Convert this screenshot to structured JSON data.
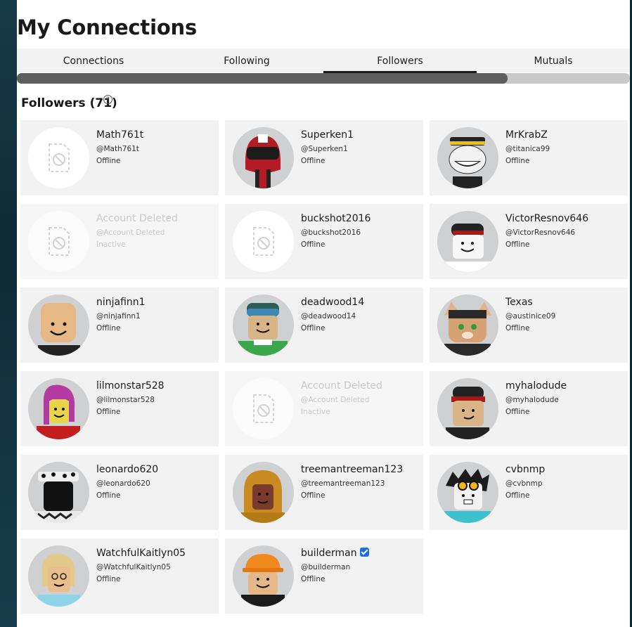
{
  "page_title": "My Connections",
  "tabs": [
    {
      "label": "Connections",
      "active": false
    },
    {
      "label": "Following",
      "active": false
    },
    {
      "label": "Followers",
      "active": true
    },
    {
      "label": "Mutuals",
      "active": false
    }
  ],
  "section": {
    "title": "Followers (71)",
    "help_icon": "question-circle-icon"
  },
  "horizontal_scroll_fraction": 0.8,
  "followers": [
    {
      "name": "Math761t",
      "handle": "@Math761t",
      "status": "Offline",
      "avatar": "blank"
    },
    {
      "name": "Superken1",
      "handle": "@Superken1",
      "status": "Offline",
      "avatar": "helmet"
    },
    {
      "name": "MrKrabZ",
      "handle": "@titanica99",
      "status": "Offline",
      "avatar": "trollface"
    },
    {
      "name": "Account Deleted",
      "handle": "@Account Deleted",
      "status": "Inactive",
      "avatar": "blank",
      "deleted": true
    },
    {
      "name": "buckshot2016",
      "handle": "@buckshot2016",
      "status": "Offline",
      "avatar": "blank"
    },
    {
      "name": "VictorResnov646",
      "handle": "@VictorResnov646",
      "status": "Offline",
      "avatar": "white-cap"
    },
    {
      "name": "ninjafinn1",
      "handle": "@ninjafinn1",
      "status": "Offline",
      "avatar": "bald"
    },
    {
      "name": "deadwood14",
      "handle": "@deadwood14",
      "status": "Offline",
      "avatar": "goggles"
    },
    {
      "name": "Texas",
      "handle": "@austinice09",
      "status": "Offline",
      "avatar": "cat"
    },
    {
      "name": "lilmonstar528",
      "handle": "@lilmonstar528",
      "status": "Offline",
      "avatar": "pink-hair"
    },
    {
      "name": "Account Deleted",
      "handle": "@Account Deleted",
      "status": "Inactive",
      "avatar": "blank",
      "deleted": true
    },
    {
      "name": "myhalodude",
      "handle": "@myhalodude",
      "status": "Offline",
      "avatar": "cap"
    },
    {
      "name": "leonardo620",
      "handle": "@leonardo620",
      "status": "Offline",
      "avatar": "masked"
    },
    {
      "name": "treemantreeman123",
      "handle": "@treemantreeman123",
      "status": "Offline",
      "avatar": "gold-helmet"
    },
    {
      "name": "cvbnmp",
      "handle": "@cvbnmp",
      "status": "Offline",
      "avatar": "spiky"
    },
    {
      "name": "WatchfulKaitlyn05",
      "handle": "@WatchfulKaitlyn05",
      "status": "Offline",
      "avatar": "blonde"
    },
    {
      "name": "builderman",
      "handle": "@builderman",
      "status": "Offline",
      "avatar": "hardhat",
      "verified": true
    }
  ],
  "colors": {
    "card_bg": "#f2f2f3",
    "tab_bg": "#f2f2f3",
    "verified": "#1e6fe0"
  }
}
